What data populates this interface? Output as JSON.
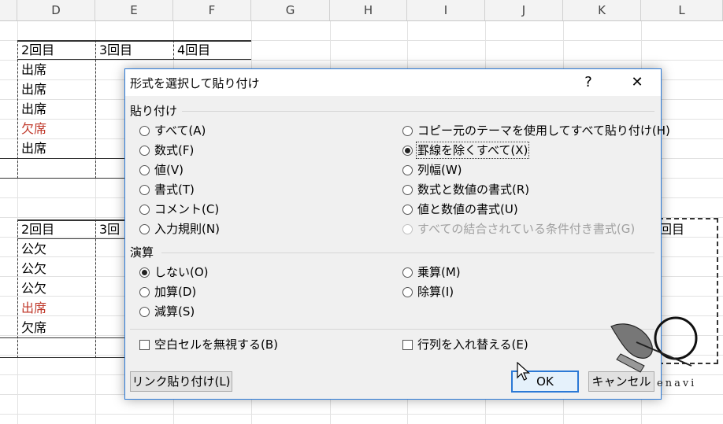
{
  "columns": [
    "D",
    "E",
    "F",
    "G",
    "H",
    "I",
    "J",
    "K",
    "L"
  ],
  "sheet": {
    "table1": {
      "headers": [
        "2回目",
        "3回目",
        "4回目"
      ],
      "values": [
        "出席",
        "出席",
        "出席",
        "欠席",
        "出席"
      ]
    },
    "table2": {
      "headers": [
        "2回目",
        "3回"
      ],
      "values": [
        "公欠",
        "公欠",
        "公欠",
        "出席",
        "欠席"
      ],
      "right_header": "回目"
    },
    "red_color": "#c0392b"
  },
  "dialog": {
    "title": "形式を選択して貼り付け",
    "help": "?",
    "close": "✕",
    "paste_section": "貼り付け",
    "paste_left": [
      "すべて(A)",
      "数式(F)",
      "値(V)",
      "書式(T)",
      "コメント(C)",
      "入力規則(N)"
    ],
    "paste_right": [
      "コピー元のテーマを使用してすべて貼り付け(H)",
      "罫線を除くすべて(X)",
      "列幅(W)",
      "数式と数値の書式(R)",
      "値と数値の書式(U)",
      "すべての結合されている条件付き書式(G)"
    ],
    "paste_selected": "罫線を除くすべて(X)",
    "operation_section": "演算",
    "op_left": [
      "しない(O)",
      "加算(D)",
      "減算(S)"
    ],
    "op_right": [
      "乗算(M)",
      "除算(I)"
    ],
    "op_selected": "しない(O)",
    "skip_blanks": "空白セルを無視する(B)",
    "transpose": "行列を入れ替える(E)",
    "paste_link": "リンク貼り付け(L)",
    "ok": "OK",
    "cancel": "キャンセル"
  },
  "logo": {
    "text": "enavi"
  },
  "accent": "#2b79d6"
}
